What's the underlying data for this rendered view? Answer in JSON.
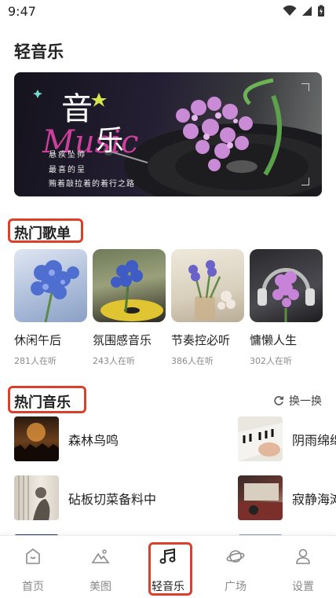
{
  "status_bar": {
    "time": "9:47"
  },
  "app": {
    "title": "轻音乐"
  },
  "banner": {
    "title_char1": "音",
    "title_char2": "乐",
    "script_text": "Music",
    "lines": [
      "悬疾坠帅",
      "最喜的呈",
      "贿着敲拉着的着行之路"
    ]
  },
  "hot_playlists": {
    "heading": "热门歌单",
    "items": [
      {
        "name": "休闲午后",
        "listeners": "281人在听"
      },
      {
        "name": "氛围感音乐",
        "listeners": "243人在听"
      },
      {
        "name": "节奏控必听",
        "listeners": "386人在听"
      },
      {
        "name": "慵懒人生",
        "listeners": "302人在听"
      }
    ]
  },
  "hot_music": {
    "heading": "热门音乐",
    "refresh_label": "换一换",
    "songs": [
      {
        "title": "森林鸟鸣"
      },
      {
        "title": "阴雨绵绵"
      },
      {
        "title": "砧板切菜备料中"
      },
      {
        "title": "寂静海滩"
      }
    ]
  },
  "bottom_nav": {
    "items": [
      {
        "label": "首页",
        "icon": "home-icon"
      },
      {
        "label": "美图",
        "icon": "image-icon"
      },
      {
        "label": "轻音乐",
        "icon": "music-note-icon",
        "active": true
      },
      {
        "label": "广场",
        "icon": "planet-icon"
      },
      {
        "label": "设置",
        "icon": "user-icon"
      }
    ]
  },
  "colors": {
    "highlight": "#d8422c",
    "text": "#222222",
    "muted": "#8a8a8a"
  }
}
